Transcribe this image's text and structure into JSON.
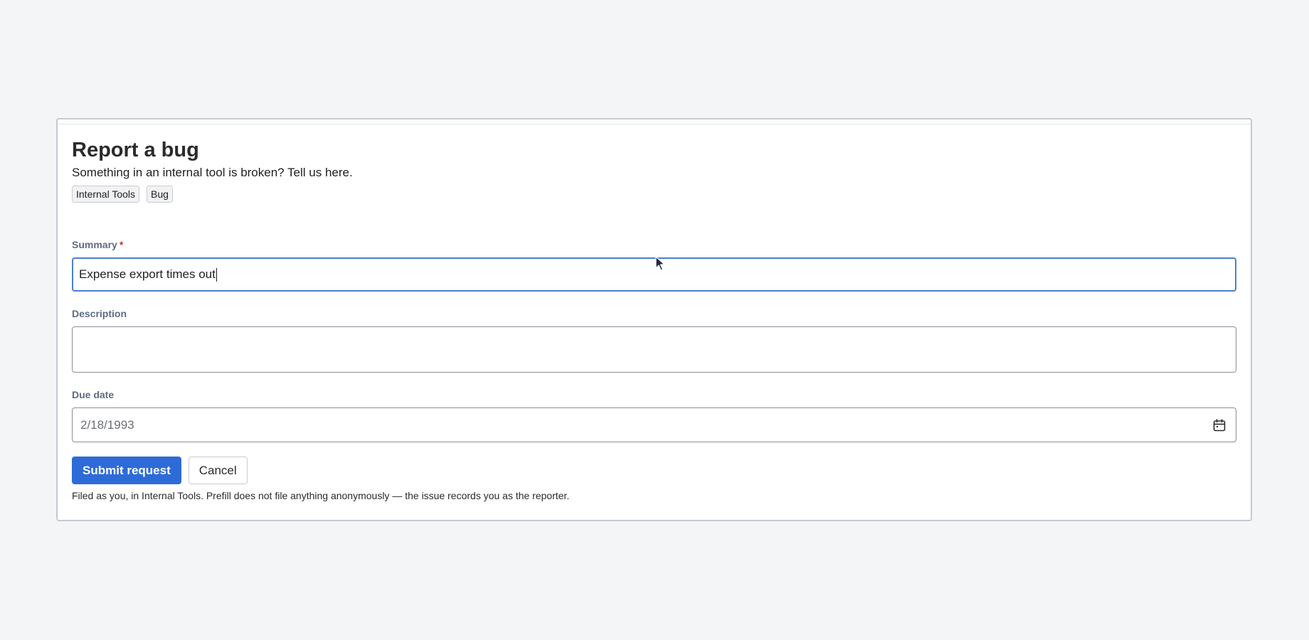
{
  "form": {
    "title": "Report a bug",
    "subtitle": "Something in an internal tool is broken? Tell us here.",
    "tags": [
      "Internal Tools",
      "Bug"
    ],
    "summary": {
      "label": "Summary",
      "required_marker": "*",
      "value": "Expense export times out"
    },
    "description": {
      "label": "Description",
      "value": ""
    },
    "due_date": {
      "label": "Due date",
      "value": "2/18/1993",
      "icon": "calendar-icon"
    },
    "buttons": {
      "submit_label": "Submit request",
      "cancel_label": "Cancel"
    },
    "footer_note": "Filed as you, in Internal Tools. Prefill does not file anything anonymously — the issue records you as the reporter."
  },
  "colors": {
    "primary": "#2d6bd8",
    "focus_border": "#4a7fd6",
    "required": "#c9372c",
    "background": "#f4f5f7"
  }
}
